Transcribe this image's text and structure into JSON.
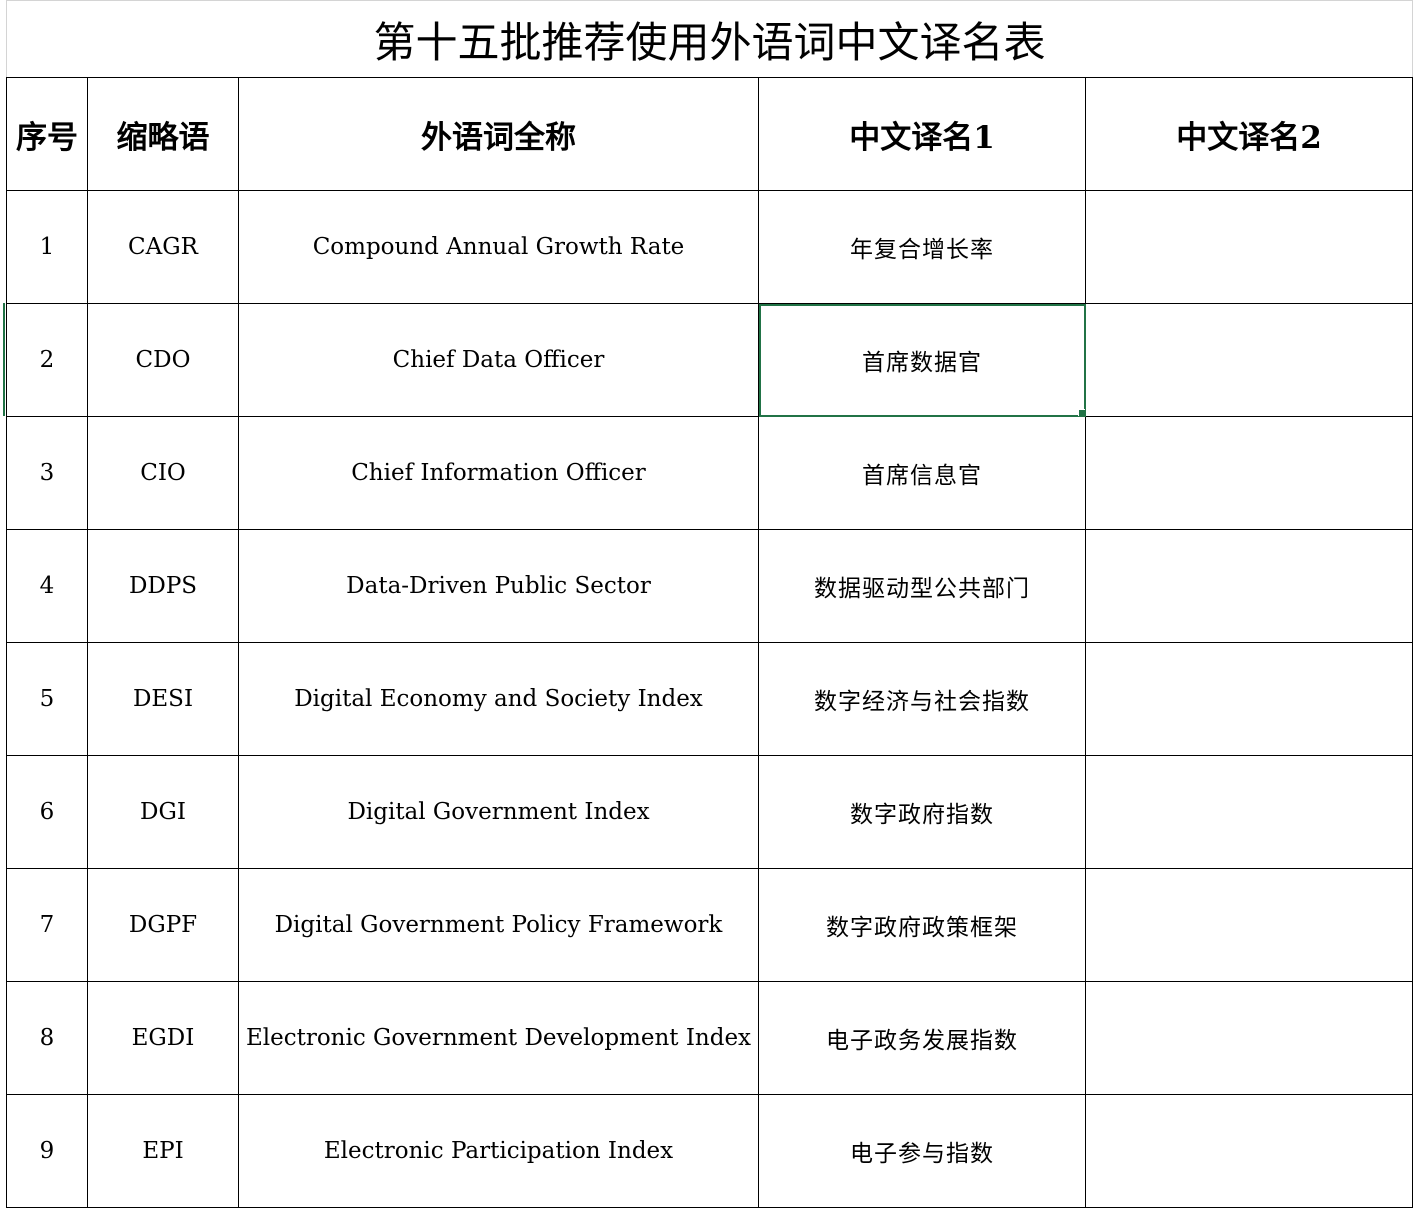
{
  "sheet": {
    "title": "第十五批推荐使用外语词中文译名表",
    "headers": [
      "序号",
      "缩略语",
      "外语词全称",
      "中文译名1",
      "中文译名2"
    ],
    "rows": [
      {
        "no": "1",
        "abbr": "CAGR",
        "full": "Compound Annual Growth Rate",
        "zh1": "年复合增长率",
        "zh2": ""
      },
      {
        "no": "2",
        "abbr": "CDO",
        "full": "Chief Data Officer",
        "zh1": "首席数据官",
        "zh2": ""
      },
      {
        "no": "3",
        "abbr": "CIO",
        "full": "Chief Information Officer",
        "zh1": "首席信息官",
        "zh2": ""
      },
      {
        "no": "4",
        "abbr": "DDPS",
        "full": "Data-Driven Public Sector",
        "zh1": "数据驱动型公共部门",
        "zh2": ""
      },
      {
        "no": "5",
        "abbr": "DESI",
        "full": "Digital Economy and Society Index",
        "zh1": "数字经济与社会指数",
        "zh2": ""
      },
      {
        "no": "6",
        "abbr": "DGI",
        "full": "Digital Government Index",
        "zh1": "数字政府指数",
        "zh2": ""
      },
      {
        "no": "7",
        "abbr": "DGPF",
        "full": "Digital Government Policy Framework",
        "zh1": "数字政府政策框架",
        "zh2": ""
      },
      {
        "no": "8",
        "abbr": "EGDI",
        "full": "Electronic Government Development Index",
        "zh1": "电子政务发展指数",
        "zh2": ""
      },
      {
        "no": "9",
        "abbr": "EPI",
        "full": "Electronic Participation Index",
        "zh1": "电子参与指数",
        "zh2": ""
      }
    ],
    "selection_color": "#217346",
    "selected_cell": "zh1 of row 2"
  }
}
